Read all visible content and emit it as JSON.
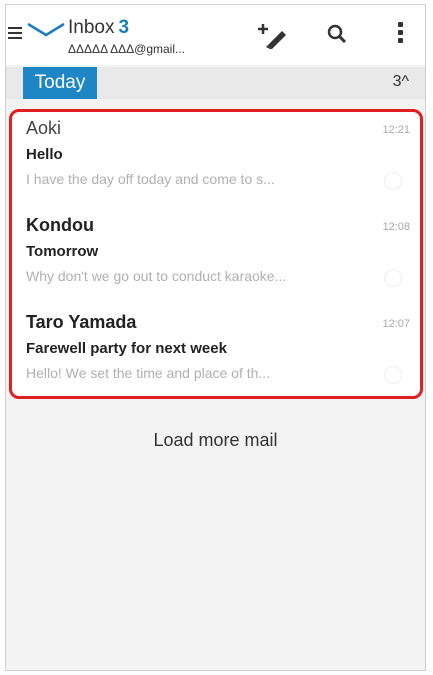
{
  "toolbar": {
    "folder_name": "Inbox",
    "unread_count": "3",
    "account": "ΔΔΔΔΔ ΔΔΔ@gmail..."
  },
  "section": {
    "label": "Today",
    "count": "3^"
  },
  "messages": [
    {
      "sender": "Aoki",
      "time": "12:21",
      "subject": "Hello",
      "snippet": "I have the day off today and come to s..."
    },
    {
      "sender": "Kondou",
      "time": "12:08",
      "subject": "Tomorrow",
      "snippet": "Why don't we go out to conduct karaoke..."
    },
    {
      "sender": "Taro Yamada",
      "time": "12:07",
      "subject": "Farewell party for next week",
      "snippet": "Hello! We set the time and place of th..."
    }
  ],
  "load_more_label": "Load more mail",
  "colors": {
    "accent": "#1f86c6",
    "highlight_border": "#e02020"
  }
}
